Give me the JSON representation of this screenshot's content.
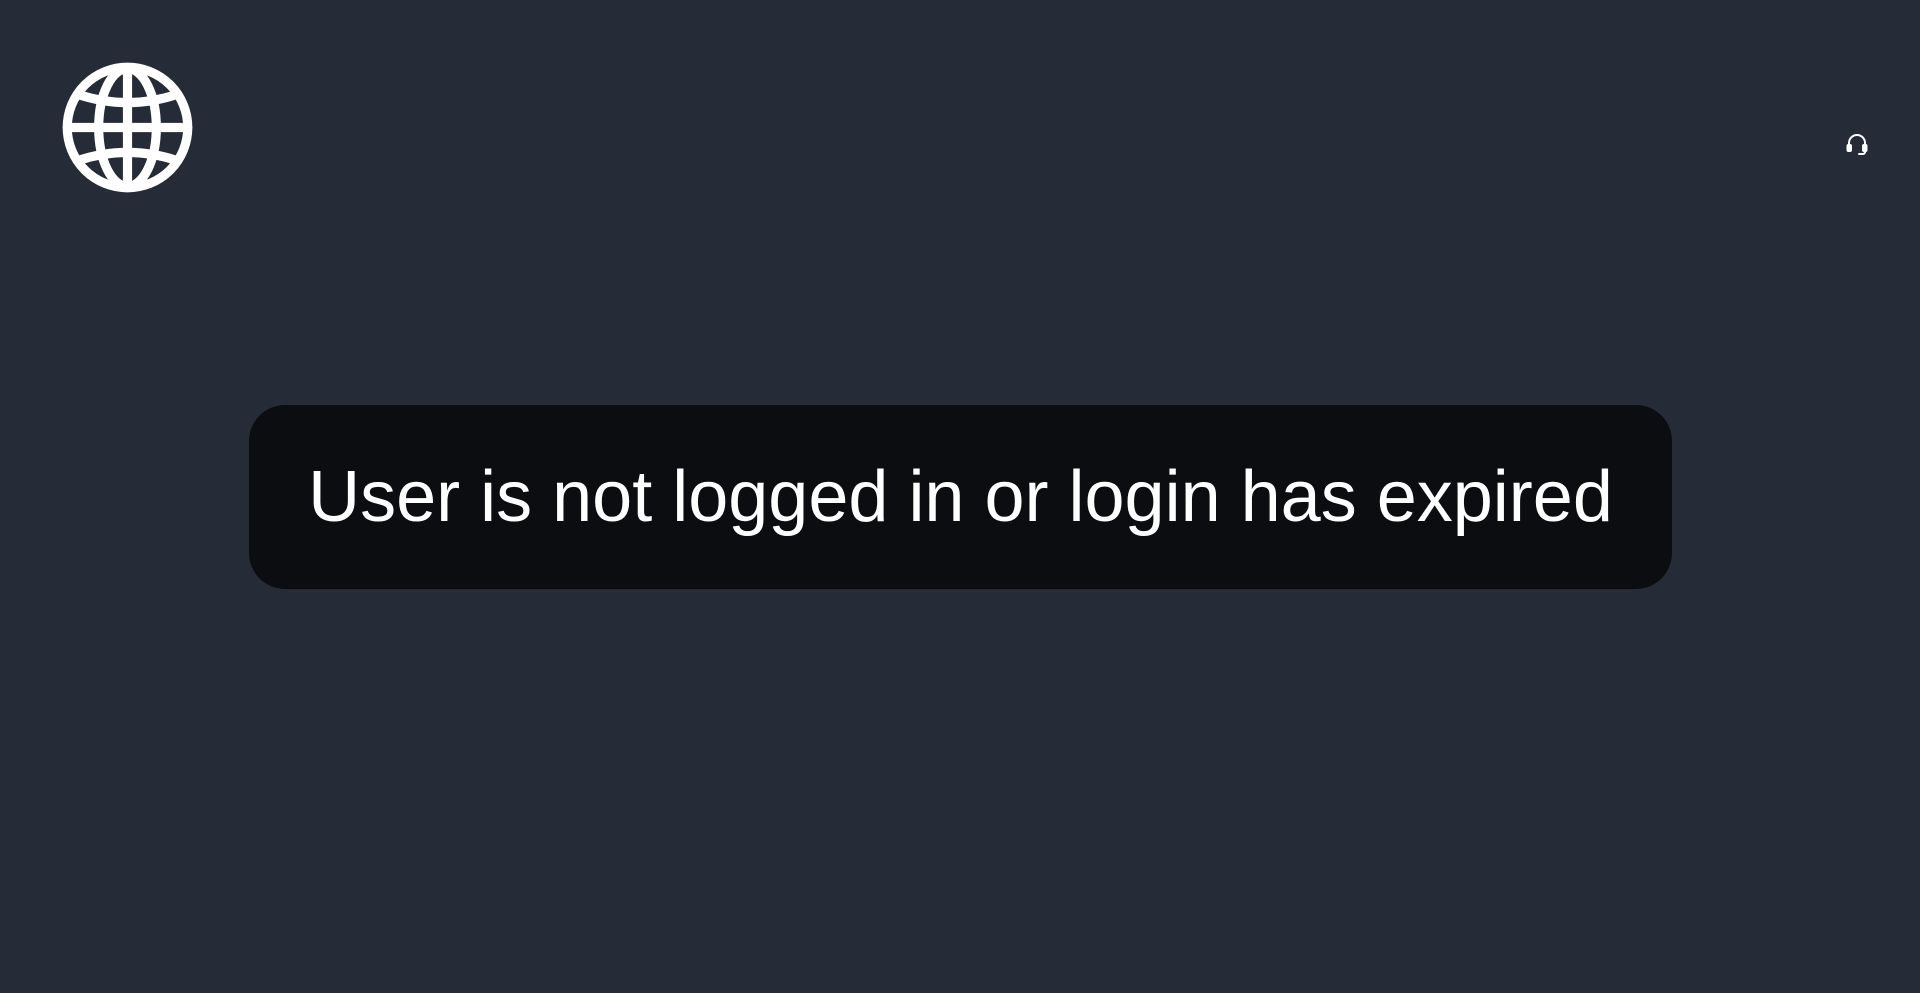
{
  "header": {
    "logo_icon": "globe-icon",
    "support_icon": "headset-icon"
  },
  "toast": {
    "message": "User is not logged in or login has expired"
  },
  "colors": {
    "background": "#252b37",
    "toast_background": "#0b0d11",
    "foreground": "#ffffff"
  }
}
